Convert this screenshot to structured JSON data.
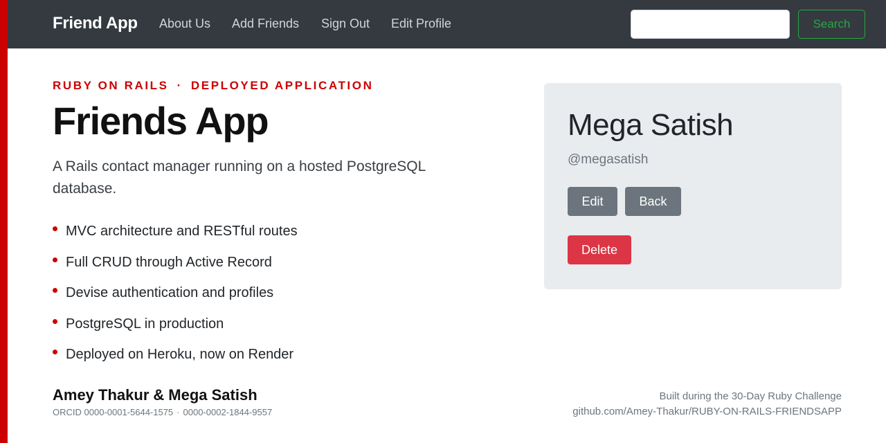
{
  "navbar": {
    "brand": "Friend App",
    "links": [
      "About Us",
      "Add Friends",
      "Sign Out",
      "Edit Profile"
    ],
    "search_placeholder": "",
    "search_button": "Search"
  },
  "hero": {
    "eyebrow_left": "RUBY ON RAILS",
    "eyebrow_sep": "·",
    "eyebrow_right": "DEPLOYED APPLICATION",
    "title": "Friends App",
    "description": "A Rails contact manager running on a hosted PostgreSQL database.",
    "features": [
      "MVC architecture and RESTful routes",
      "Full CRUD through Active Record",
      "Devise authentication and profiles",
      "PostgreSQL in production",
      "Deployed on Heroku, now on Render"
    ]
  },
  "authors": {
    "first": "Amey Thakur",
    "amp": "&",
    "second": "Mega Satish",
    "orcid_label": "ORCID 0000-0001-5644-1575",
    "orcid_sep": "·",
    "orcid_second": "0000-0002-1844-9557"
  },
  "footer": {
    "line1": "Built during the 30-Day Ruby Challenge",
    "line2": "github.com/Amey-Thakur/RUBY-ON-RAILS-FRIENDSAPP"
  },
  "profile_card": {
    "name": "Mega Satish",
    "handle": "@megasatish",
    "edit_label": "Edit",
    "back_label": "Back",
    "delete_label": "Delete"
  },
  "colors": {
    "accent": "#cc0000",
    "navbar": "#343a40",
    "success": "#28a745",
    "danger": "#dc3545",
    "secondary": "#6c757d",
    "card_bg": "#e9ecef"
  }
}
